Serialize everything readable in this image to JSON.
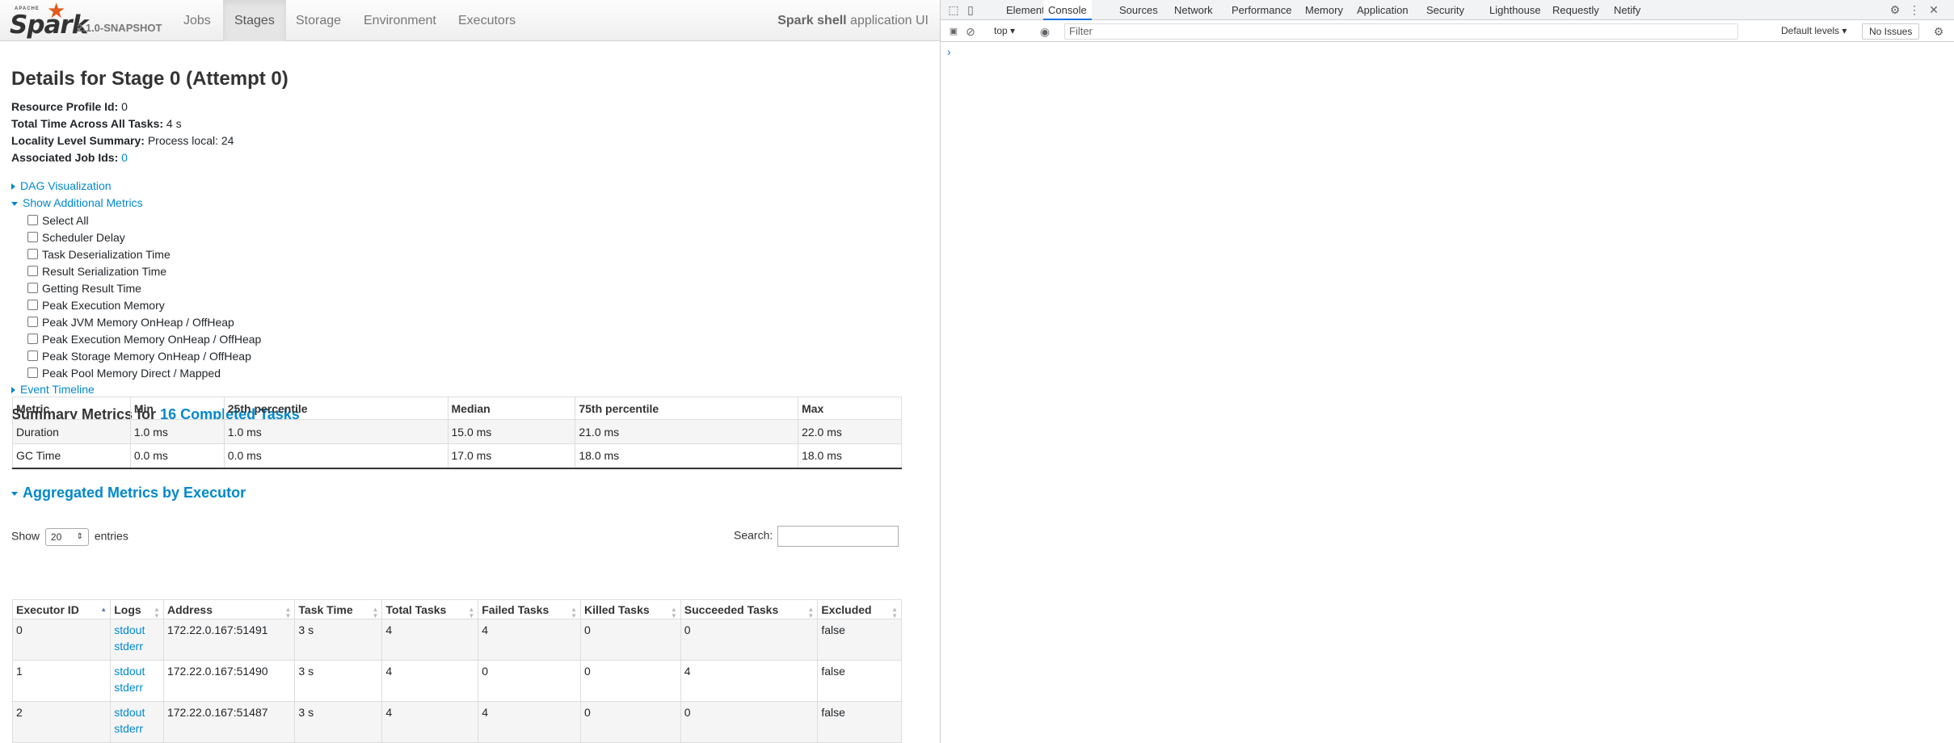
{
  "navbar": {
    "brand_small": "APACHE",
    "brand_name": "Spark",
    "version": "2.1.0-SNAPSHOT",
    "items": [
      {
        "label": "Jobs"
      },
      {
        "label": "Stages"
      },
      {
        "label": "Storage"
      },
      {
        "label": "Environment"
      },
      {
        "label": "Executors"
      }
    ],
    "active": "Stages",
    "app_name_bold": "Spark shell",
    "app_name_suffix": " application UI"
  },
  "page": {
    "title": "Details for Stage 0 (Attempt 0)",
    "summary": [
      {
        "label": "Resource Profile Id:",
        "value": " 0"
      },
      {
        "label": "Total Time Across All Tasks:",
        "value": " 4 s"
      },
      {
        "label": "Locality Level Summary:",
        "value": " Process local: 24"
      },
      {
        "label": "Associated Job Ids:",
        "value": "0"
      }
    ],
    "dag_toggle": "DAG Visualization",
    "additional_metrics_toggle": "Show Additional Metrics",
    "metrics_checkboxes": [
      "Select All",
      "Scheduler Delay",
      "Task Deserialization Time",
      "Result Serialization Time",
      "Getting Result Time",
      "Peak Execution Memory",
      "Peak JVM Memory OnHeap / OffHeap",
      "Peak Execution Memory OnHeap / OffHeap",
      "Peak Storage Memory OnHeap / OffHeap",
      "Peak Pool Memory Direct / Mapped"
    ],
    "event_timeline_toggle": "Event Timeline",
    "summary_metrics_prefix": "Summary Metrics for ",
    "summary_metrics_link": "16 Completed Tasks",
    "summary_table": {
      "headers": [
        "Metric",
        "Min",
        "25th percentile",
        "Median",
        "75th percentile",
        "Max"
      ],
      "rows": [
        [
          "Duration",
          "1.0 ms",
          "1.0 ms",
          "15.0 ms",
          "21.0 ms",
          "22.0 ms"
        ],
        [
          "GC Time",
          "0.0 ms",
          "0.0 ms",
          "17.0 ms",
          "18.0 ms",
          "18.0 ms"
        ]
      ]
    },
    "aggregated_title": "Aggregated Metrics by Executor",
    "show_label": "Show",
    "show_value": "20",
    "entries_label": "entries",
    "search_label": "Search:",
    "executor_table": {
      "headers": [
        "Executor ID",
        "Logs",
        "Address",
        "Task Time",
        "Total Tasks",
        "Failed Tasks",
        "Killed Tasks",
        "Succeeded Tasks",
        "Excluded"
      ],
      "rows": [
        {
          "id": "0",
          "stdout": "stdout",
          "stderr": "stderr",
          "address": "172.22.0.167:51491",
          "task_time": "3 s",
          "total": "4",
          "failed": "4",
          "killed": "0",
          "succeeded": "0",
          "excluded": "false"
        },
        {
          "id": "1",
          "stdout": "stdout",
          "stderr": "stderr",
          "address": "172.22.0.167:51490",
          "task_time": "3 s",
          "total": "4",
          "failed": "0",
          "killed": "0",
          "succeeded": "4",
          "excluded": "false"
        },
        {
          "id": "2",
          "stdout": "stdout",
          "stderr": "stderr",
          "address": "172.22.0.167:51487",
          "task_time": "3 s",
          "total": "4",
          "failed": "4",
          "killed": "0",
          "succeeded": "0",
          "excluded": "false"
        }
      ]
    }
  },
  "devtools": {
    "tabs": [
      "Elements",
      "Console",
      "Sources",
      "Network",
      "Performance",
      "Memory",
      "Application",
      "Security",
      "Lighthouse",
      "Requestly",
      "Netify"
    ],
    "active_tab": "Console",
    "context": "top",
    "filter_placeholder": "Filter",
    "levels": "Default levels",
    "issues": "No Issues",
    "prompt": "›"
  },
  "colors": {
    "link": "#0088cc",
    "spark_orange": "#e25a1c",
    "devtools_accent": "#1a73e8"
  }
}
